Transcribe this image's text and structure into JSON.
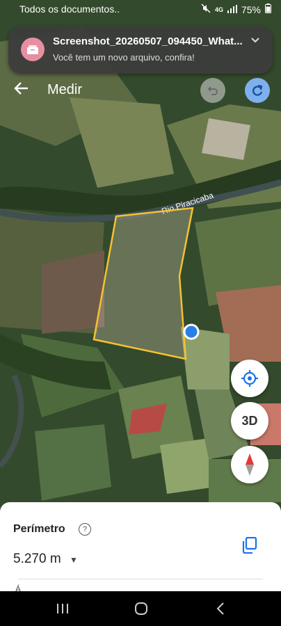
{
  "status": {
    "left_text": "Todos os documentos..",
    "network": "4G",
    "battery": "75%"
  },
  "notification": {
    "title": "Screenshot_20260507_094450_What...",
    "body": "Você tem um novo arquivo, confira!"
  },
  "header": {
    "title": "Medir"
  },
  "map": {
    "river_label": "Rio Piracicaba",
    "polygon_color": "#f5c231",
    "point_color": "#2a7fe6"
  },
  "fab": {
    "threed_label": "3D"
  },
  "sheet": {
    "perimeter_label": "Perímetro",
    "help_symbol": "?",
    "perimeter_value": "5.270 m",
    "next_peek": "Á"
  }
}
